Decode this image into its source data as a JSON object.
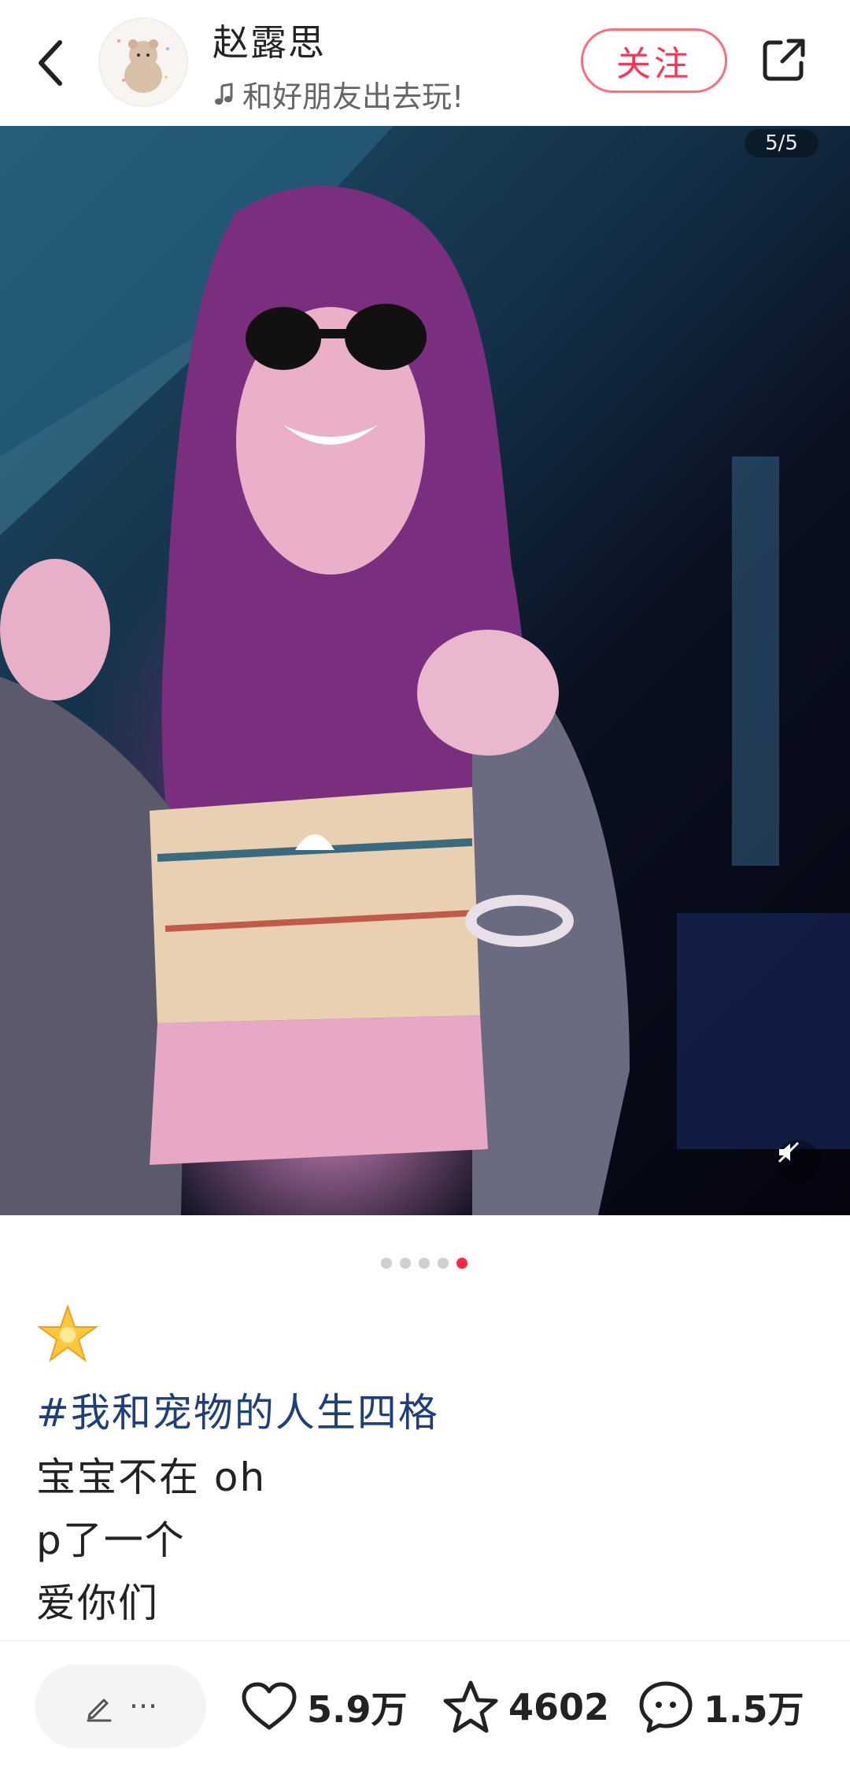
{
  "header": {
    "username": "赵露思",
    "music_text": "和好朋友出去玩!",
    "follow_label": "关注"
  },
  "photo": {
    "counter": "5/5",
    "total_images": 5,
    "active_index": 5
  },
  "post": {
    "emoji": "🌟",
    "hashtag": "#我和宠物的人生四格",
    "lines": [
      "宝宝不在 oh",
      "p了一个",
      "爱你们"
    ]
  },
  "bottom": {
    "comment_dots": "···",
    "likes": "5.9万",
    "favorites": "4602",
    "comments": "1.5万"
  },
  "colors": {
    "accent": "#ff2442",
    "follow_border": "#ff6b7a",
    "hashtag": "#1f3f7a"
  },
  "icons": [
    "back-icon",
    "music-note-icon",
    "share-icon",
    "mute-icon",
    "star-emoji-icon",
    "pencil-icon",
    "heart-icon",
    "star-icon",
    "comment-icon"
  ]
}
